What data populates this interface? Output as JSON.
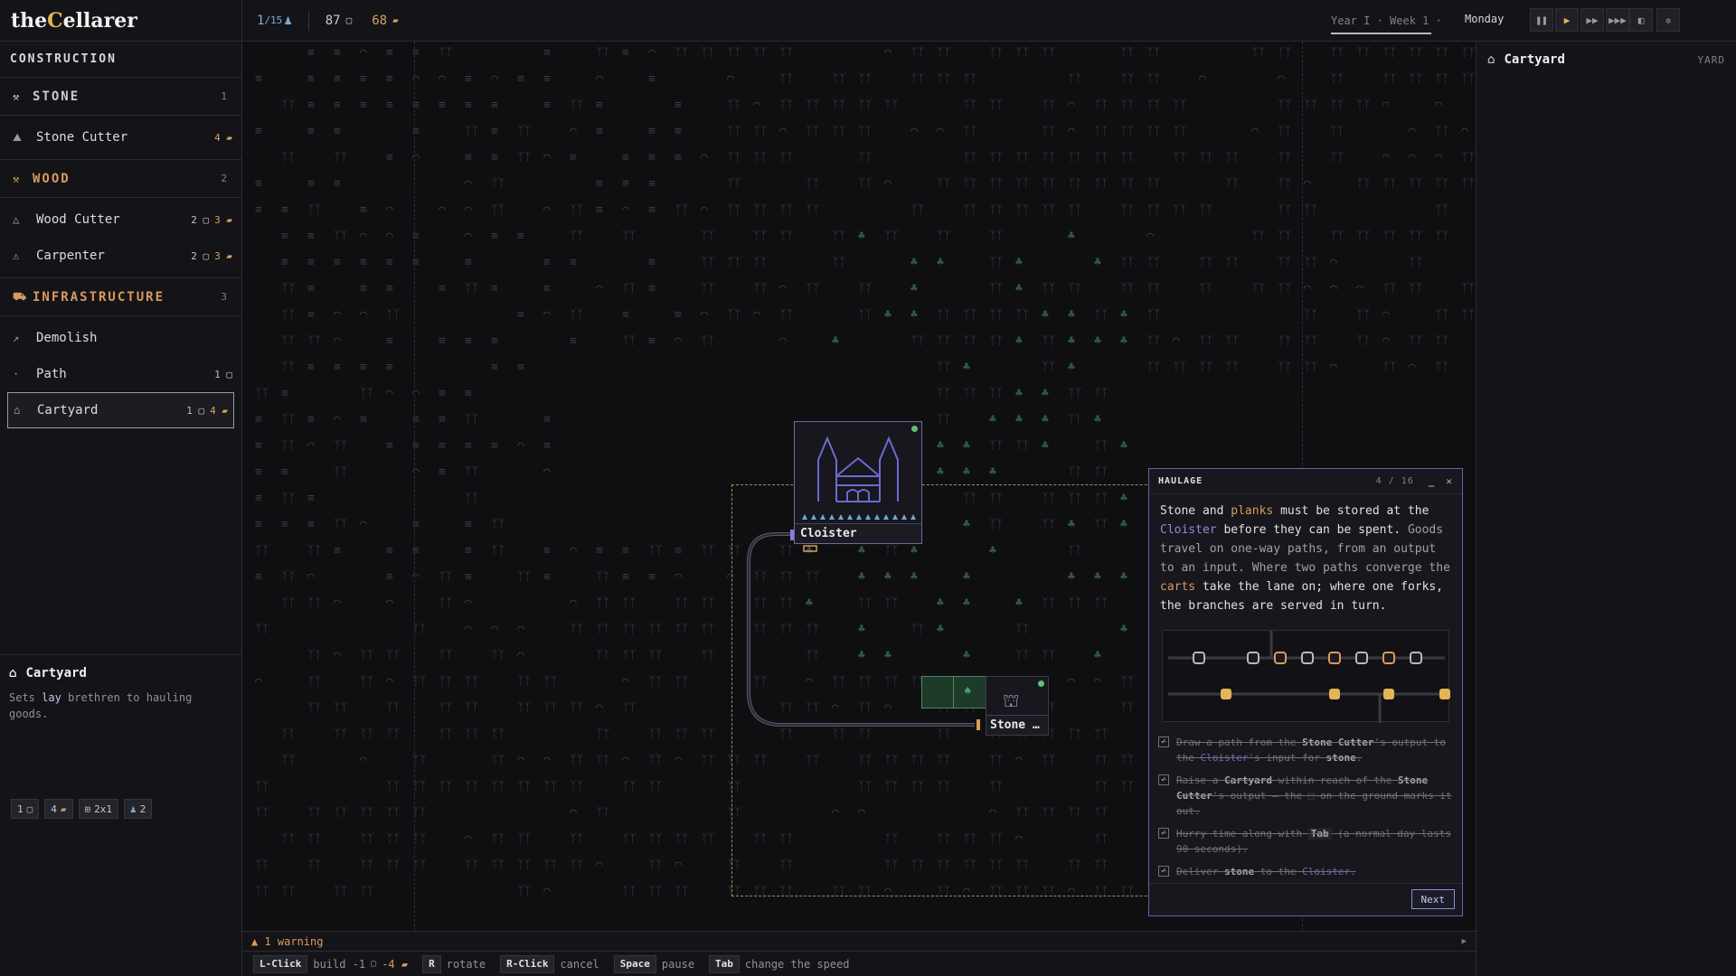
{
  "app": {
    "title_prefix": "the ",
    "title_letter": "C",
    "title_rest": "ellarer"
  },
  "sidebar": {
    "section": "CONSTRUCTION",
    "categories": [
      {
        "label": "STONE",
        "count": "1",
        "items": [
          {
            "label": "Stone Cutter",
            "cost_stone": "",
            "cost_planks": "4"
          }
        ]
      },
      {
        "label": "WOOD",
        "count": "2",
        "items": [
          {
            "label": "Wood Cutter",
            "cost_stone": "2",
            "cost_planks": "3"
          },
          {
            "label": "Carpenter",
            "cost_stone": "2",
            "cost_planks": "3"
          }
        ]
      },
      {
        "label": "INFRASTRUCTURE",
        "count": "3",
        "items": [
          {
            "label": "Demolish",
            "cost_stone": "",
            "cost_planks": ""
          },
          {
            "label": "Path",
            "cost_stone": "1",
            "cost_planks": ""
          },
          {
            "label": "Cartyard",
            "cost_stone": "1",
            "cost_planks": "4"
          }
        ]
      }
    ],
    "selected": "Cartyard",
    "info": {
      "title": "Cartyard",
      "desc_pre": "Sets ",
      "desc_hl": "lay",
      "desc_post": " brethren to hauling goods.",
      "chips": {
        "stone": "1",
        "planks": "4",
        "size": "2x1",
        "workers": "2"
      }
    }
  },
  "topbar": {
    "population": "1",
    "population_max": "/15",
    "stone": "87",
    "planks": "68",
    "date": "Year I · Week 1 ·",
    "day": "Monday"
  },
  "map": {
    "cloister_label": "Cloister",
    "stonecutter_label": "Stone …"
  },
  "right_panel": {
    "title": "Cartyard",
    "tag": "YARD"
  },
  "tutorial": {
    "title": "HAULAGE",
    "page": "4 / 16",
    "t1": "Stone",
    "t2": " and ",
    "t3": "planks",
    "t4": " must be stored at the ",
    "t5": "Cloister",
    "t6": " before they can be spent. ",
    "t7": "Goods travel on one-way paths, from an output to an input. Where two paths converge the ",
    "t8": "carts",
    "t9": " take the lane on; where one forks, the branches are served in turn.",
    "tasks": [
      {
        "a": "Draw a path from the ",
        "b": "Stone Cutter",
        "c": "'s output to the ",
        "d": "Cloister",
        "e": "'s input for ",
        "f": "stone",
        "g": "."
      },
      {
        "a": "Raise a ",
        "b": "Cartyard",
        "c": " within reach of the ",
        "d": "Stone Cutter",
        "e": "'s output — the ",
        "f": "⬚",
        "g": " on the ground marks it out."
      },
      {
        "a": "Hurry time along with ",
        "b": "Tab",
        "c": " (a normal day lasts 90 seconds).",
        "d": "",
        "e": "",
        "f": "",
        "g": ""
      },
      {
        "a": "Deliver ",
        "b": "stone",
        "c": " to the ",
        "d": "Cloister",
        "e": ".",
        "f": "",
        "g": ""
      }
    ],
    "next": "Next"
  },
  "warnings": "▲ 1 warning",
  "help": [
    {
      "key": "L-Click",
      "desc": "build -1",
      "extra": "-4"
    },
    {
      "key": "R",
      "desc": "rotate",
      "extra": ""
    },
    {
      "key": "R-Click",
      "desc": "cancel",
      "extra": ""
    },
    {
      "key": "Space",
      "desc": "pause",
      "extra": ""
    },
    {
      "key": "Tab",
      "desc": "change the speed",
      "extra": ""
    }
  ]
}
